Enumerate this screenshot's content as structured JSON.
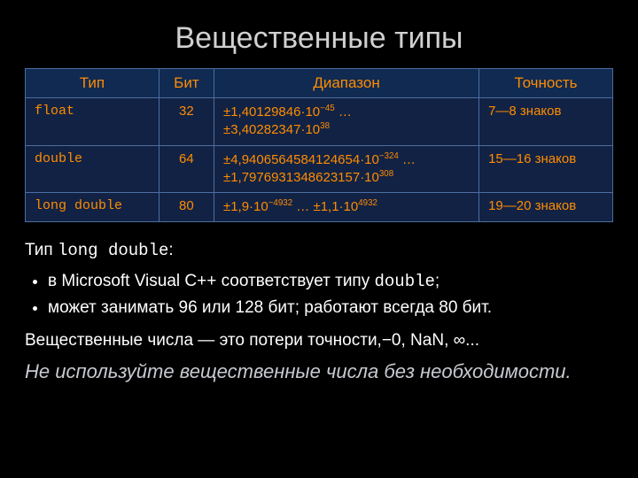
{
  "title": "Вещественные типы",
  "table": {
    "headers": {
      "type": "Тип",
      "bits": "Бит",
      "range": "Диапазон",
      "precision": "Точность"
    },
    "rows": [
      {
        "type": "float",
        "bits": "32",
        "range_l1_pre": "±1,40129846·10",
        "range_l1_sup": "−45",
        "range_l1_post": " …",
        "range_l2_pre": "±3,40282347·10",
        "range_l2_sup": "38",
        "range_l2_post": "",
        "precision": "7—8 знаков"
      },
      {
        "type": "double",
        "bits": "64",
        "range_l1_pre": "±4,9406564584124654·10",
        "range_l1_sup": "−324",
        "range_l1_post": " …",
        "range_l2_pre": "±1,7976931348623157·10",
        "range_l2_sup": "308",
        "range_l2_post": "",
        "precision": "15—16 знаков"
      },
      {
        "type": "long double",
        "bits": "80",
        "range_l1_pre": "±1,9·10",
        "range_l1_sup": "−4932",
        "range_l1_post": " … ±1,1·10",
        "range_l2_pre": "",
        "range_l2_sup": "4932",
        "range_l2_post": "",
        "precision": "19—20 знаков"
      }
    ]
  },
  "body": {
    "intro_pre": "Тип ",
    "intro_code": "long double",
    "intro_post": ":",
    "bullet1_pre": "в Microsoft Visual C++ соответствует типу ",
    "bullet1_code": "double",
    "bullet1_post": ";",
    "bullet2": "может занимать 96 или 128 бит; работают всегда 80 бит.",
    "para2": "Вещественные числа — это потери точности,−0, NaN, ∞...",
    "advice": "Не используйте вещественные числа без необходимости."
  }
}
